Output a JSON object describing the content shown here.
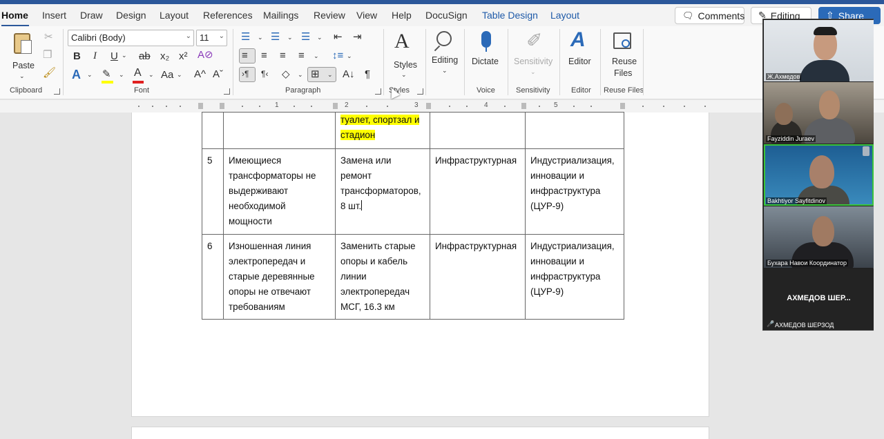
{
  "tabs": {
    "items": [
      "Home",
      "Insert",
      "Draw",
      "Design",
      "Layout",
      "References",
      "Mailings",
      "Review",
      "View",
      "Help",
      "DocuSign"
    ],
    "contextual": [
      "Table Design",
      "Layout"
    ],
    "comments_label": "Comments",
    "editing_label": "Editing",
    "share_label": "Share"
  },
  "ribbon": {
    "clipboard": {
      "paste_label": "Paste",
      "group_label": "Clipboard"
    },
    "font": {
      "font_name": "Calibri (Body)",
      "font_size": "11",
      "group_label": "Font",
      "bold": "B",
      "italic": "I",
      "underline": "U",
      "strike": "ab",
      "subscript": "x₂",
      "superscript": "x²",
      "change_case": "Aa",
      "grow": "A^",
      "shrink": "Aˇ"
    },
    "paragraph": {
      "group_label": "Paragraph"
    },
    "styles": {
      "label": "Styles",
      "group_label": "Styles"
    },
    "editing": {
      "label": "Editing"
    },
    "voice": {
      "label": "Dictate",
      "group_label": "Voice"
    },
    "sensitivity": {
      "label": "Sensitivity",
      "group_label": "Sensitivity"
    },
    "editor": {
      "label": "Editor",
      "group_label": "Editor"
    },
    "reuse": {
      "label_line1": "Reuse",
      "label_line2": "Files",
      "group_label": "Reuse Files"
    }
  },
  "ruler": {
    "numbers": [
      "1",
      "2",
      "3",
      "4",
      "5"
    ]
  },
  "document": {
    "table": {
      "partial_row": {
        "col3_highlighted_line1": "туалет, спортзал и",
        "col3_highlighted_line2": "стадион"
      },
      "rows": [
        {
          "num": "5",
          "problem": "Имеющиеся трансформаторы не выдерживают необходимой мощности",
          "solution": "Замена или ремонт трансформаторов, 8 шт.",
          "type": "Инфраструктурная",
          "goal": "Индустриализация, инновации и инфраструктура (ЦУР-9)"
        },
        {
          "num": "6",
          "problem": "Изношенная линия электропередач и старые деревянные опоры не отвечают требованиям",
          "solution": "Заменить старые опоры и кабель линии электропередач МСГ, 16.3 км",
          "type": "Инфраструктурная",
          "goal": "Индустриализация, инновации и инфраструктура (ЦУР-9)"
        }
      ]
    }
  },
  "video": {
    "participants": [
      {
        "name": "Ж.Ахмедов"
      },
      {
        "name": "Fayziddin Juraev"
      },
      {
        "name": "Bakhtiyor Sayfitdinov"
      },
      {
        "name": "Бухара  Навои Координатор"
      },
      {
        "name": "АХМЕДОВ ШЕРЗОД",
        "display": "АХМЕДОВ  ШЕР..."
      }
    ]
  },
  "colors": {
    "accent": "#2b579a",
    "contextual_tab": "#1e5aa8",
    "highlight": "#ffff00",
    "active_speaker": "#3bc43b"
  }
}
